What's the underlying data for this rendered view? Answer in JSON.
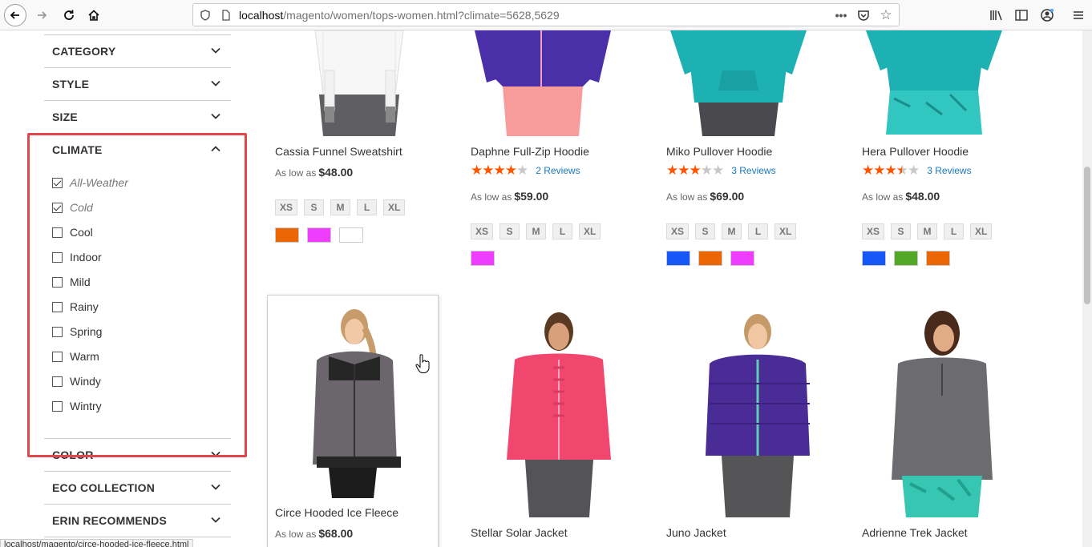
{
  "browser": {
    "url_host": "localhost",
    "url_path": "/magento/women/tops-women.html?climate=5628,5629",
    "status_url": "localhost/magento/circe-hooded-ice-fleece.html"
  },
  "sidebar": {
    "facets_top": [
      {
        "title": "CATEGORY"
      },
      {
        "title": "STYLE"
      },
      {
        "title": "SIZE"
      }
    ],
    "climate": {
      "title": "CLIMATE",
      "options": [
        {
          "label": "All-Weather",
          "checked": true
        },
        {
          "label": "Cold",
          "checked": true
        },
        {
          "label": "Cool",
          "checked": false
        },
        {
          "label": "Indoor",
          "checked": false
        },
        {
          "label": "Mild",
          "checked": false
        },
        {
          "label": "Rainy",
          "checked": false
        },
        {
          "label": "Spring",
          "checked": false
        },
        {
          "label": "Warm",
          "checked": false
        },
        {
          "label": "Windy",
          "checked": false
        },
        {
          "label": "Wintry",
          "checked": false
        }
      ]
    },
    "facets_bottom": [
      {
        "title": "COLOR"
      },
      {
        "title": "ECO COLLECTION"
      },
      {
        "title": "ERIN RECOMMENDS"
      }
    ]
  },
  "price_prefix": "As low as",
  "products": [
    {
      "name": "Cassia Funnel Sweatshirt",
      "price": "$48.00",
      "rating": 0,
      "reviews": "",
      "sizes": [
        "XS",
        "S",
        "M",
        "L",
        "XL"
      ],
      "swatches": [
        "#eb6703",
        "#ef3dff",
        "#ffffff"
      ]
    },
    {
      "name": "Daphne Full-Zip Hoodie",
      "price": "$59.00",
      "rating": 4,
      "reviews": "2 Reviews",
      "sizes": [
        "XS",
        "S",
        "M",
        "L",
        "XL"
      ],
      "swatches": [
        "#ef3dff"
      ]
    },
    {
      "name": "Miko Pullover Hoodie",
      "price": "$69.00",
      "rating": 3,
      "reviews": "3 Reviews",
      "sizes": [
        "XS",
        "S",
        "M",
        "L",
        "XL"
      ],
      "swatches": [
        "#1857f7",
        "#eb6703",
        "#ef3dff"
      ]
    },
    {
      "name": "Hera Pullover Hoodie",
      "price": "$48.00",
      "rating": 3.5,
      "reviews": "3 Reviews",
      "sizes": [
        "XS",
        "S",
        "M",
        "L",
        "XL"
      ],
      "swatches": [
        "#1857f7",
        "#53a828",
        "#eb6703"
      ]
    },
    {
      "name": "Circe Hooded Ice Fleece",
      "price": "$68.00"
    },
    {
      "name": "Stellar Solar Jacket"
    },
    {
      "name": "Juno Jacket"
    },
    {
      "name": "Adrienne Trek Jacket"
    }
  ],
  "colors": {
    "accent_star": "#ff5501",
    "link": "#1979c3",
    "highlight_box": "#e0474c"
  }
}
